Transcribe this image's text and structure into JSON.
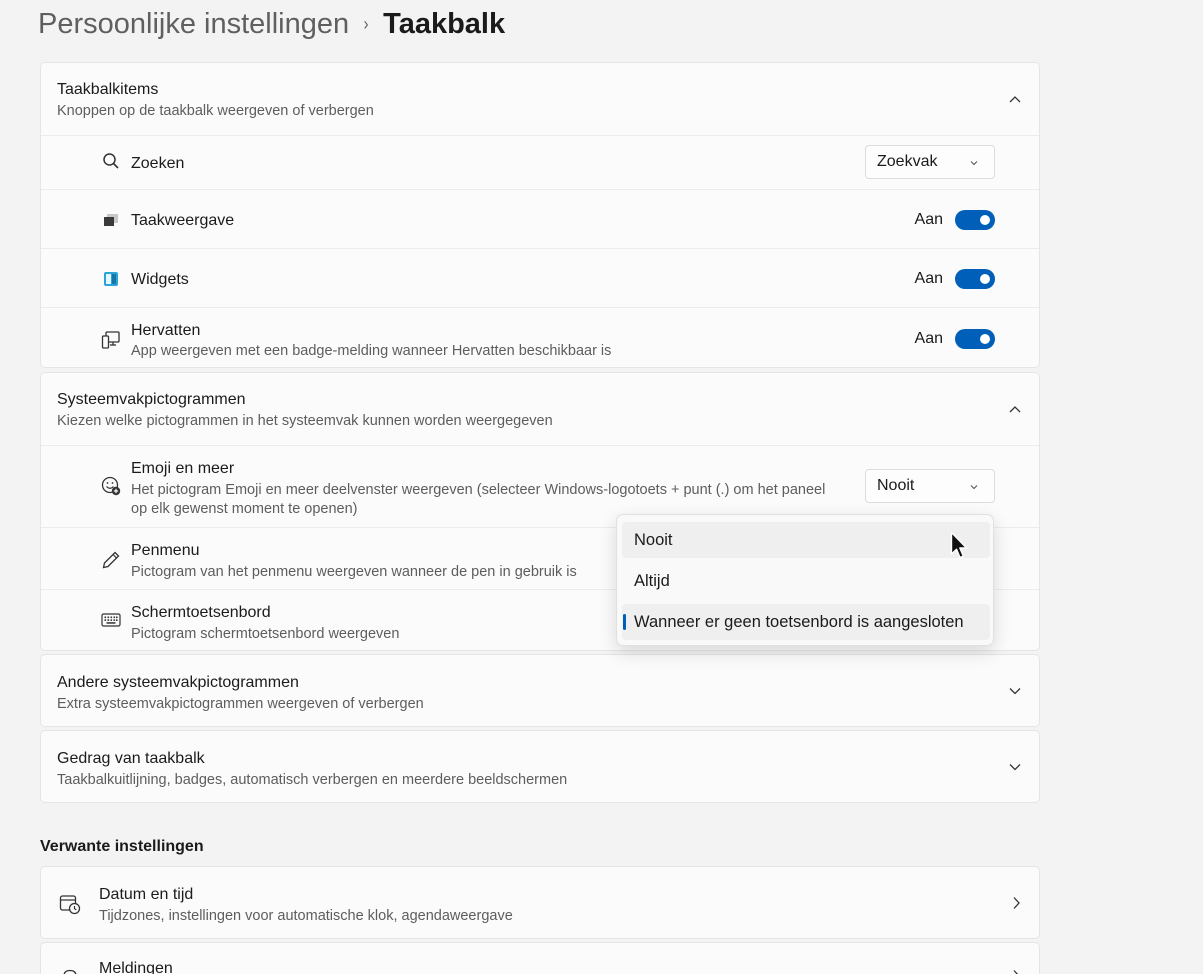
{
  "breadcrumb": {
    "parent": "Persoonlijke instellingen",
    "separator": "›",
    "current": "Taakbalk"
  },
  "taskbar_items": {
    "title": "Taakbalkitems",
    "subtitle": "Knoppen op de taakbalk weergeven of verbergen",
    "items": [
      {
        "label": "Zoeken",
        "icon": "search-icon",
        "control": "combo",
        "value": "Zoekvak"
      },
      {
        "label": "Taakweergave",
        "icon": "task-view-icon",
        "control": "toggle",
        "state_label": "Aan",
        "on": true
      },
      {
        "label": "Widgets",
        "icon": "widgets-icon",
        "control": "toggle",
        "state_label": "Aan",
        "on": true
      },
      {
        "label": "Hervatten",
        "sublabel": "App weergeven met een badge-melding wanneer Hervatten beschikbaar is",
        "icon": "resume-icon",
        "control": "toggle",
        "state_label": "Aan",
        "on": true
      }
    ]
  },
  "tray_icons": {
    "title": "Systeemvakpictogrammen",
    "subtitle": "Kiezen welke pictogrammen in het systeemvak kunnen worden weergegeven",
    "items": [
      {
        "label": "Emoji en meer",
        "sublabel": "Het pictogram Emoji en meer deelvenster weergeven (selecteer Windows-logotoets + punt (.) om het paneel op elk gewenst moment te openen)",
        "icon": "emoji-icon",
        "value": "Nooit"
      },
      {
        "label": "Penmenu",
        "sublabel": "Pictogram van het penmenu weergeven wanneer de pen in gebruik is",
        "icon": "pen-icon"
      },
      {
        "label": "Schermtoetsenbord",
        "sublabel": "Pictogram schermtoetsenbord weergeven",
        "icon": "keyboard-icon"
      }
    ]
  },
  "other_tray": {
    "title": "Andere systeemvakpictogrammen",
    "subtitle": "Extra systeemvakpictogrammen weergeven of verbergen"
  },
  "behavior": {
    "title": "Gedrag van taakbalk",
    "subtitle": "Taakbalkuitlijning, badges, automatisch verbergen en meerdere beeldschermen"
  },
  "related": {
    "title": "Verwante instellingen",
    "items": [
      {
        "label": "Datum en tijd",
        "sublabel": "Tijdzones, instellingen voor automatische klok, agendaweergave",
        "icon": "calendar-clock-icon"
      },
      {
        "label": "Meldingen",
        "icon": "bell-icon"
      }
    ]
  },
  "dropdown": {
    "options": [
      "Nooit",
      "Altijd",
      "Wanneer er geen toetsenbord is aangesloten"
    ],
    "hovered": "Nooit",
    "selected": "Wanneer er geen toetsenbord is aangesloten"
  },
  "colors": {
    "accent": "#005fb8",
    "background": "#f3f3f3",
    "card": "#fbfbfb"
  }
}
